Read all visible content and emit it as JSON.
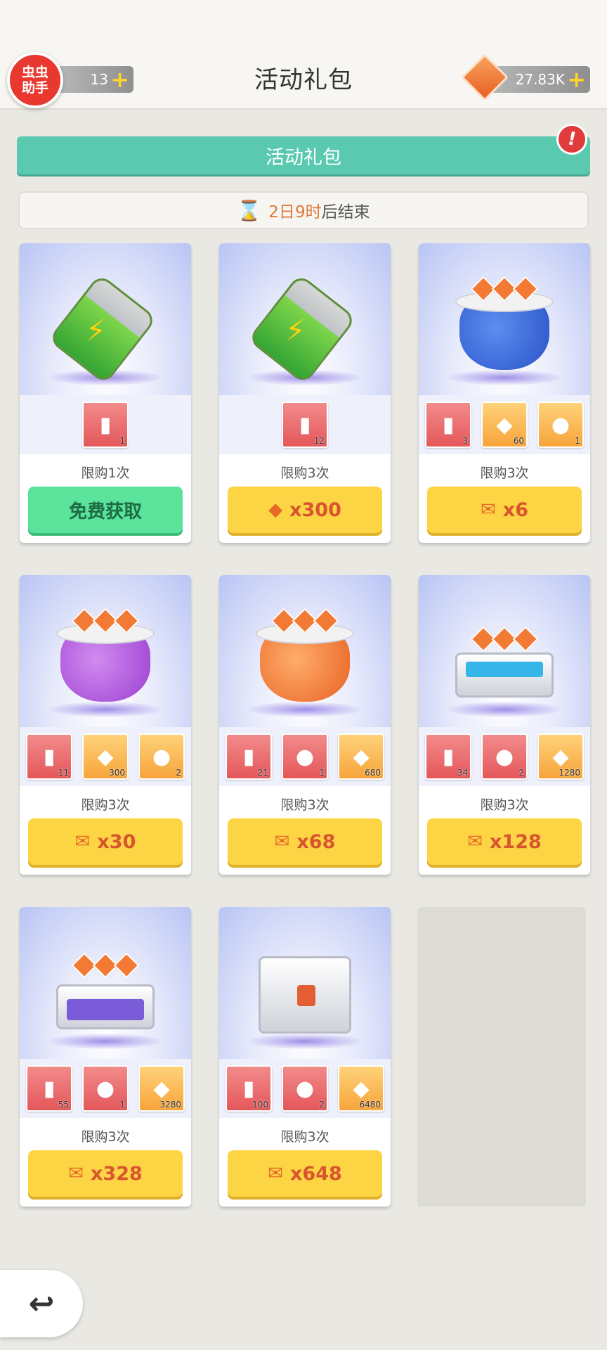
{
  "header": {
    "logo_text": "虫虫\n助手",
    "left_count": "13",
    "title": "活动礼包",
    "gem_count": "27.83K",
    "plus": "+"
  },
  "banner": {
    "label": "活动礼包",
    "alert": "!"
  },
  "timer": {
    "days": "2日",
    "hours": "9时",
    "suffix": "后结束"
  },
  "cards": [
    {
      "limit": "限购1次",
      "price": "免费获取",
      "currency": "",
      "items": [
        {
          "count": "1"
        }
      ]
    },
    {
      "limit": "限购3次",
      "price": "x300",
      "currency": "gem-icon",
      "items": [
        {
          "count": "12"
        }
      ]
    },
    {
      "limit": "限购3次",
      "price": "x6",
      "currency": "ticket-icon",
      "items": [
        {
          "count": "3"
        },
        {
          "count": "60"
        },
        {
          "count": "1"
        }
      ]
    },
    {
      "limit": "限购3次",
      "price": "x30",
      "currency": "ticket-icon",
      "items": [
        {
          "count": "11"
        },
        {
          "count": "300"
        },
        {
          "count": "2"
        }
      ]
    },
    {
      "limit": "限购3次",
      "price": "x68",
      "currency": "ticket-icon",
      "items": [
        {
          "count": "21"
        },
        {
          "count": "1"
        },
        {
          "count": "680"
        }
      ]
    },
    {
      "limit": "限购3次",
      "price": "x128",
      "currency": "ticket-icon",
      "items": [
        {
          "count": "34"
        },
        {
          "count": "2"
        },
        {
          "count": "1280"
        }
      ]
    },
    {
      "limit": "限购3次",
      "price": "x328",
      "currency": "ticket-icon",
      "items": [
        {
          "count": "55"
        },
        {
          "count": "1"
        },
        {
          "count": "3280"
        }
      ]
    },
    {
      "limit": "限购3次",
      "price": "x648",
      "currency": "ticket-icon",
      "items": [
        {
          "count": "100"
        },
        {
          "count": "2"
        },
        {
          "count": "6480"
        }
      ]
    }
  ],
  "glyphs": {
    "back": "↩",
    "hourglass": "⌛",
    "battery": "▮",
    "gem": "◆",
    "ticket": "✉",
    "bag": "●"
  },
  "colors": {
    "accent_green": "#5ac9af",
    "buy_yellow": "#fdd443",
    "free_green": "#5be39b",
    "alert_red": "#e23b3b"
  }
}
